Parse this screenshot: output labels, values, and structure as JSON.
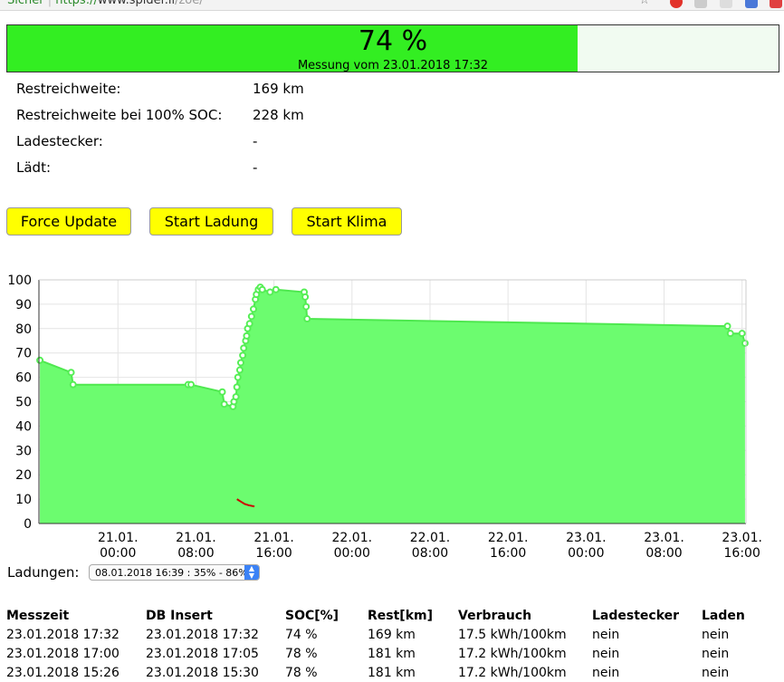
{
  "browser": {
    "secure_label": "Sicher",
    "url_scheme": "https://",
    "url_host": "www.spider.li",
    "url_path": "/zoe/"
  },
  "soc": {
    "percent_text": "74 %",
    "fill_fraction": 0.74,
    "measure_text": "Messung vom 23.01.2018 17:32"
  },
  "info": [
    {
      "label": "Restreichweite:",
      "value": "169 km"
    },
    {
      "label": "Restreichweite bei 100% SOC:",
      "value": "228 km"
    },
    {
      "label": "Ladestecker:",
      "value": "-"
    },
    {
      "label": "Lädt:",
      "value": "-"
    }
  ],
  "buttons": {
    "force_update": "Force Update",
    "start_ladung": "Start Ladung",
    "start_klima": "Start Klima"
  },
  "chart_data": {
    "type": "area",
    "ylim": [
      0,
      100
    ],
    "yticks": [
      0,
      10,
      20,
      30,
      40,
      50,
      60,
      70,
      80,
      90,
      100
    ],
    "xticks": [
      {
        "day": "21.01.",
        "time": "00:00",
        "h": 24
      },
      {
        "day": "21.01.",
        "time": "08:00",
        "h": 32
      },
      {
        "day": "21.01.",
        "time": "16:00",
        "h": 40
      },
      {
        "day": "22.01.",
        "time": "00:00",
        "h": 48
      },
      {
        "day": "22.01.",
        "time": "08:00",
        "h": 56
      },
      {
        "day": "22.01.",
        "time": "16:00",
        "h": 64
      },
      {
        "day": "23.01.",
        "time": "00:00",
        "h": 72
      },
      {
        "day": "23.01.",
        "time": "08:00",
        "h": 80
      },
      {
        "day": "23.01.",
        "time": "16:00",
        "h": 88
      }
    ],
    "xlim_hours": [
      15.9,
      88.4
    ],
    "x_hours": [
      16.0,
      19.2,
      19.4,
      31.2,
      31.5,
      34.7,
      34.9,
      35.8,
      35.9,
      36.1,
      36.2,
      36.3,
      36.5,
      36.6,
      36.8,
      36.9,
      37.1,
      37.2,
      37.3,
      37.5,
      37.7,
      37.9,
      38.1,
      38.2,
      38.4,
      38.6,
      38.8,
      39.6,
      40.2,
      43.1,
      43.2,
      43.3,
      43.4,
      86.5,
      86.8,
      88.0,
      88.3
    ],
    "y_soc": [
      67,
      62,
      57,
      57,
      57,
      54,
      49,
      48,
      50,
      52,
      56,
      60,
      63,
      66,
      69,
      72,
      75,
      77,
      80,
      82,
      85,
      88,
      92,
      94,
      96,
      97,
      96,
      95,
      96,
      95,
      93,
      89,
      84,
      81,
      78,
      78,
      74
    ],
    "red_marker": {
      "x_hours": [
        36.2,
        36.6,
        37.0,
        37.4,
        38.0
      ],
      "y": [
        10,
        9,
        8,
        7.5,
        7
      ]
    },
    "colors": {
      "area": "#6cfc6f",
      "line": "#4ee84f",
      "point": "#55ee55",
      "marker": "#cc0000"
    }
  },
  "ladungen": {
    "label": "Ladungen:",
    "selected": "08.01.2018 16:39 : 35% - 86%"
  },
  "table": {
    "headers": [
      "Messzeit",
      "DB Insert",
      "SOC[%]",
      "Rest[km]",
      "Verbrauch",
      "Ladestecker",
      "Laden"
    ],
    "rows": [
      [
        "23.01.2018 17:32",
        "23.01.2018 17:32",
        "74 %",
        "169 km",
        "17.5 kWh/100km",
        "nein",
        "nein"
      ],
      [
        "23.01.2018 17:00",
        "23.01.2018 17:05",
        "78 %",
        "181 km",
        "17.2 kWh/100km",
        "nein",
        "nein"
      ],
      [
        "23.01.2018 15:26",
        "23.01.2018 15:30",
        "78 %",
        "181 km",
        "17.2 kWh/100km",
        "nein",
        "nein"
      ]
    ]
  }
}
